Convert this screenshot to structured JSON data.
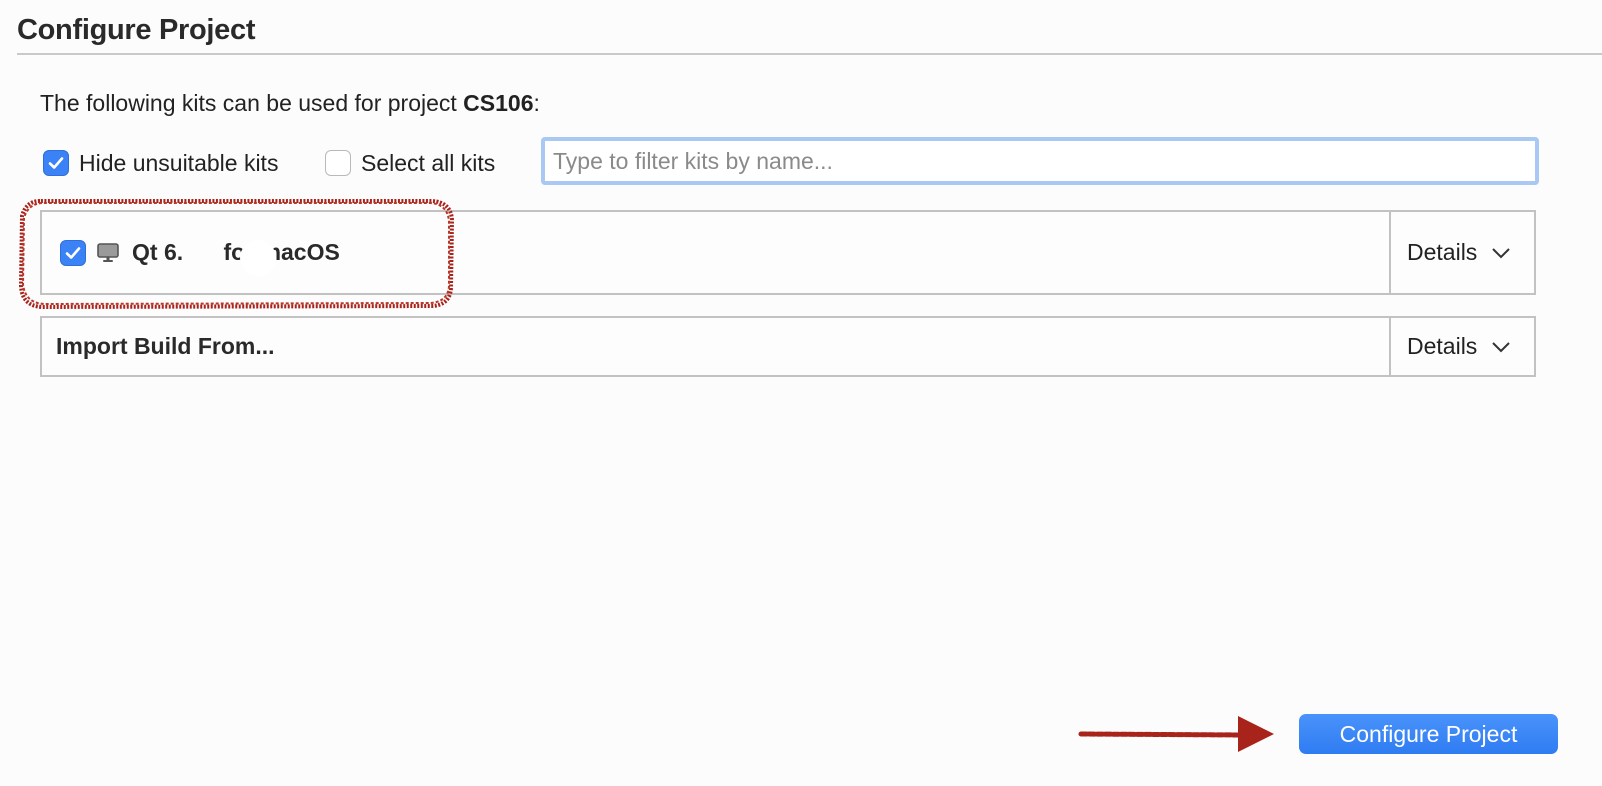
{
  "page": {
    "title": "Configure Project",
    "intro_prefix": "The following kits can be used for project ",
    "project_name": "CS106",
    "intro_suffix": ":"
  },
  "options": {
    "hide_unsuitable": {
      "label": "Hide unsuitable kits",
      "checked": true
    },
    "select_all": {
      "label": "Select all kits",
      "checked": false
    }
  },
  "filter": {
    "placeholder": "Type to filter kits by name...",
    "value": ""
  },
  "kits": [
    {
      "name_prefix": "Qt 6.",
      "name_suffix": " for macOS",
      "checked": true,
      "icon": "monitor-icon",
      "details_label": "Details"
    }
  ],
  "import_build": {
    "label": "Import Build From...",
    "details_label": "Details"
  },
  "actions": {
    "configure_label": "Configure Project"
  },
  "colors": {
    "accent": "#3b82f6",
    "annotation": "#a8231a",
    "focus_ring": "#a9c8f3"
  }
}
